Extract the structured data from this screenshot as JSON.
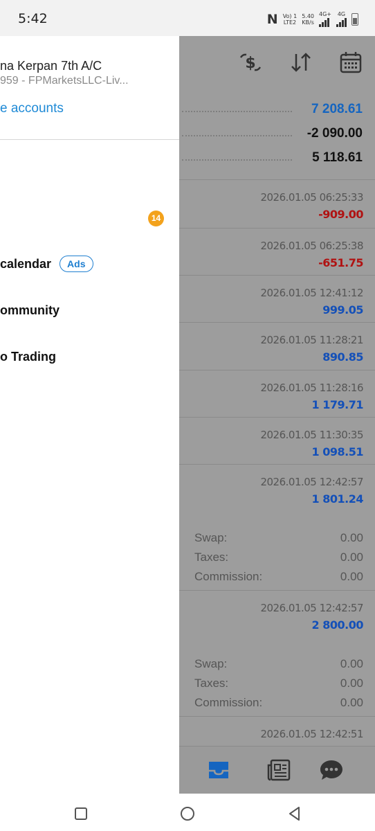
{
  "status_bar": {
    "time": "5:42",
    "n_icon": "N",
    "volte_top": "Vo) 1",
    "volte_bottom": "LTE2",
    "speed_top": "5.40",
    "speed_bottom": "KB/s",
    "net1": "4G+",
    "net2": "4G"
  },
  "drawer": {
    "account_name": "na Kerpan 7th A/C",
    "account_sub": "959 - FPMarketsLLC-Liv...",
    "manage_link": "e accounts",
    "badge_count": "14",
    "menu": [
      {
        "label": "calendar",
        "pill": "Ads"
      },
      {
        "label": "ommunity"
      },
      {
        "label": "o Trading"
      }
    ]
  },
  "panel": {
    "toolbar_icons": [
      "currency-exchange-icon",
      "sort-icon",
      "calendar-icon"
    ],
    "summary": [
      "7 208.61",
      "-2 090.00",
      "5 118.61"
    ],
    "deals": [
      {
        "datetime": "2026.01.05 06:25:33",
        "amount": "-909.00"
      },
      {
        "datetime": "2026.01.05 06:25:38",
        "amount": "-651.75"
      },
      {
        "datetime": "2026.01.05 12:41:12",
        "amount": "999.05"
      },
      {
        "datetime": "2026.01.05 11:28:21",
        "amount": "890.85"
      },
      {
        "datetime": "2026.01.05 11:28:16",
        "amount": "1 179.71"
      },
      {
        "datetime": "2026.01.05 11:30:35",
        "amount": "1 098.51"
      },
      {
        "datetime": "2026.01.05 12:42:57",
        "amount": "1 801.24"
      },
      {
        "datetime": "2026.01.05 12:42:57",
        "amount": "2 800.00"
      },
      {
        "datetime": "2026.01.05 12:42:51",
        "amount": ""
      }
    ],
    "details_1": [
      {
        "label": "Swap:",
        "value": "0.00"
      },
      {
        "label": "Taxes:",
        "value": "0.00"
      },
      {
        "label": "Commission:",
        "value": "0.00"
      }
    ],
    "details_2": [
      {
        "label": "Swap:",
        "value": "0.00"
      },
      {
        "label": "Taxes:",
        "value": "0.00"
      },
      {
        "label": "Commission:",
        "value": "0.00"
      }
    ],
    "bottom_nav_icons": [
      "inbox-icon",
      "news-icon",
      "chat-icon"
    ]
  },
  "colors": {
    "accent_blue": "#1f8ad6",
    "value_blue": "#1565c0",
    "negative_red": "#b01212",
    "badge_orange": "#f3a21c",
    "panel_gray": "#9d9d9d"
  }
}
